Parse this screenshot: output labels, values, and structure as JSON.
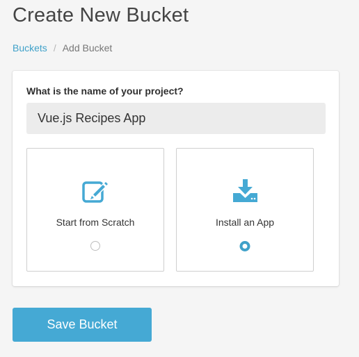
{
  "header": {
    "title": "Create New Bucket"
  },
  "breadcrumb": {
    "items": [
      {
        "label": "Buckets",
        "link": true
      },
      {
        "label": "Add Bucket",
        "link": false
      }
    ],
    "separator": "/"
  },
  "form": {
    "project_question": "What is the name of your project?",
    "project_name_value": "Vue.js Recipes App",
    "options": [
      {
        "label": "Start from Scratch",
        "icon": "edit-icon",
        "selected": false
      },
      {
        "label": "Install an App",
        "icon": "download-icon",
        "selected": true
      }
    ]
  },
  "actions": {
    "save_label": "Save Bucket"
  },
  "colors": {
    "accent": "#45a9d4",
    "link": "#3fa1c9",
    "background": "#f5f5f5",
    "input_background": "#ececec"
  }
}
